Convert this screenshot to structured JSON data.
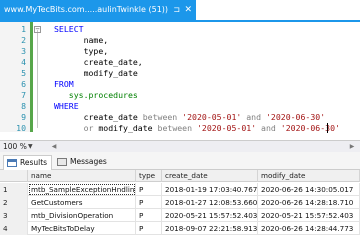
{
  "tab": {
    "title": "www.MyTecBits.com.....aulinTwinkle (51))",
    "pin_glyph": "⊐",
    "close_glyph": "✕"
  },
  "editor": {
    "lines": [
      {
        "n": "1",
        "parts": [
          {
            "c": "kw",
            "t": "SELECT"
          }
        ]
      },
      {
        "n": "2",
        "parts": [
          {
            "c": "id",
            "t": "      name,"
          }
        ]
      },
      {
        "n": "3",
        "parts": [
          {
            "c": "id",
            "t": "      type,"
          }
        ]
      },
      {
        "n": "4",
        "parts": [
          {
            "c": "id",
            "t": "      create_date,"
          }
        ]
      },
      {
        "n": "5",
        "parts": [
          {
            "c": "id",
            "t": "      modify_date"
          }
        ]
      },
      {
        "n": "6",
        "parts": [
          {
            "c": "kw",
            "t": "FROM"
          }
        ]
      },
      {
        "n": "7",
        "parts": [
          {
            "c": "sys",
            "t": "   sys.procedures"
          }
        ]
      },
      {
        "n": "8",
        "parts": [
          {
            "c": "kw",
            "t": "WHERE"
          }
        ]
      },
      {
        "n": "9",
        "parts": [
          {
            "c": "id",
            "t": "      create_date "
          },
          {
            "c": "gray",
            "t": "between "
          },
          {
            "c": "str",
            "t": "'2020-05-01'"
          },
          {
            "c": "gray",
            "t": " and "
          },
          {
            "c": "str",
            "t": "'2020-06-30'"
          }
        ]
      },
      {
        "n": "10",
        "parts": [
          {
            "c": "gray",
            "t": "      or "
          },
          {
            "c": "id",
            "t": "modify_date "
          },
          {
            "c": "gray",
            "t": "between "
          },
          {
            "c": "str",
            "t": "'2020-05-01'"
          },
          {
            "c": "gray",
            "t": " and "
          },
          {
            "c": "str",
            "t": "'2020-06-30'"
          }
        ]
      }
    ]
  },
  "zoom": {
    "value": "100 %",
    "arrow": "▼"
  },
  "results": {
    "tabs": [
      {
        "label": "Results",
        "icon": "grid-icon"
      },
      {
        "label": "Messages",
        "icon": "messages-icon"
      }
    ],
    "columns": [
      "name",
      "type",
      "create_date",
      "modify_date"
    ],
    "rows": [
      {
        "num": "1",
        "name": "mtb_SampleExceptionHndling",
        "type": "P",
        "create_date": "2018-01-19 17:03:40.767",
        "modify_date": "2020-06-26 14:30:05.017"
      },
      {
        "num": "2",
        "name": "GetCustomers",
        "type": "P",
        "create_date": "2018-01-27 12:08:53.660",
        "modify_date": "2020-06-26 14:28:18.710"
      },
      {
        "num": "3",
        "name": "mtb_DivisionOperation",
        "type": "P",
        "create_date": "2020-05-21 15:57:52.403",
        "modify_date": "2020-05-21 15:57:52.403"
      },
      {
        "num": "4",
        "name": "MyTecBitsToDelay",
        "type": "P",
        "create_date": "2018-09-07 22:21:58.913",
        "modify_date": "2020-06-26 14:28:44.773"
      }
    ]
  },
  "colors": {
    "tab_blue": "#1c97ea",
    "keyword": "#0000ff",
    "string": "#a31515",
    "system": "#008000",
    "line_number": "#2b91af",
    "change_bar": "#57a64a"
  }
}
